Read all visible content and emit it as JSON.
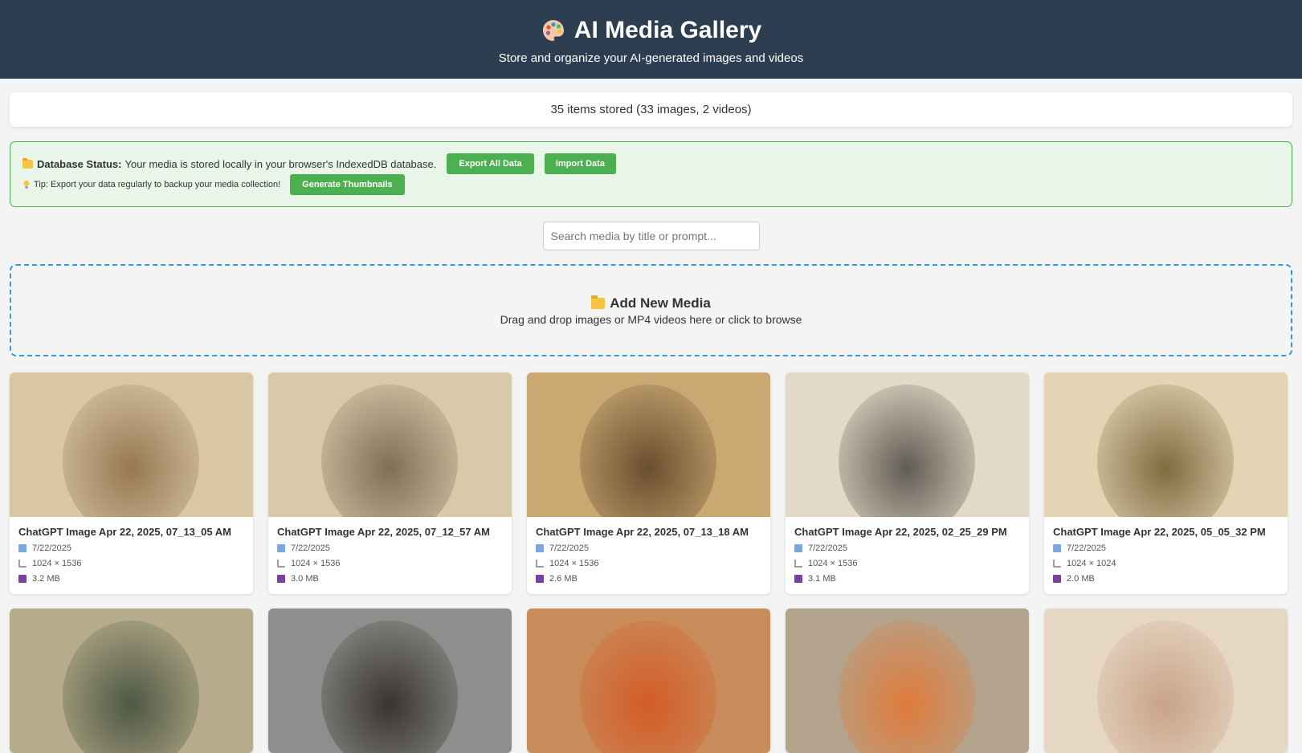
{
  "header": {
    "title": "AI Media Gallery",
    "subtitle": "Store and organize your AI-generated images and videos"
  },
  "stats": {
    "text": "35 items stored (33 images, 2 videos)"
  },
  "db_status": {
    "label": "Database Status:",
    "message": "Your media is stored locally in your browser's IndexedDB database.",
    "export_label": "Export All Data",
    "import_label": "Import Data",
    "tip": "Tip: Export your data regularly to backup your media collection!",
    "thumbnails_label": "Generate Thumbnails"
  },
  "search": {
    "placeholder": "Search media by title or prompt..."
  },
  "dropzone": {
    "title": "Add New Media",
    "hint": "Drag and drop images or MP4 videos here or click to browse"
  },
  "cards": [
    {
      "title": "ChatGPT Image Apr 22, 2025, 07_13_05 AM",
      "date": "7/22/2025",
      "dimensions": "1024 × 1536",
      "size": "3.2 MB",
      "colors": [
        "#d9c7a3",
        "#8a6a45"
      ]
    },
    {
      "title": "ChatGPT Image Apr 22, 2025, 07_12_57 AM",
      "date": "7/22/2025",
      "dimensions": "1024 × 1536",
      "size": "3.0 MB",
      "colors": [
        "#d8c9a8",
        "#6e5f48"
      ]
    },
    {
      "title": "ChatGPT Image Apr 22, 2025, 07_13_18 AM",
      "date": "7/22/2025",
      "dimensions": "1024 × 1536",
      "size": "2.6 MB",
      "colors": [
        "#c9a871",
        "#5a3e24"
      ]
    },
    {
      "title": "ChatGPT Image Apr 22, 2025, 02_25_29 PM",
      "date": "7/22/2025",
      "dimensions": "1024 × 1536",
      "size": "3.1 MB",
      "colors": [
        "#e2d9c6",
        "#4a4640"
      ]
    },
    {
      "title": "ChatGPT Image Apr 22, 2025, 05_05_32 PM",
      "date": "7/22/2025",
      "dimensions": "1024 × 1024",
      "size": "2.0 MB",
      "colors": [
        "#e3d4b4",
        "#6d5a2c"
      ]
    },
    {
      "colors": [
        "#b6ab8a",
        "#3c4a38"
      ]
    },
    {
      "colors": [
        "#8d8f8c",
        "#2b2422"
      ]
    },
    {
      "colors": [
        "#c88c5a",
        "#d5531f"
      ]
    },
    {
      "colors": [
        "#b3a38c",
        "#e7742d"
      ]
    },
    {
      "colors": [
        "#e6d7c5",
        "#c39a7c"
      ]
    }
  ]
}
